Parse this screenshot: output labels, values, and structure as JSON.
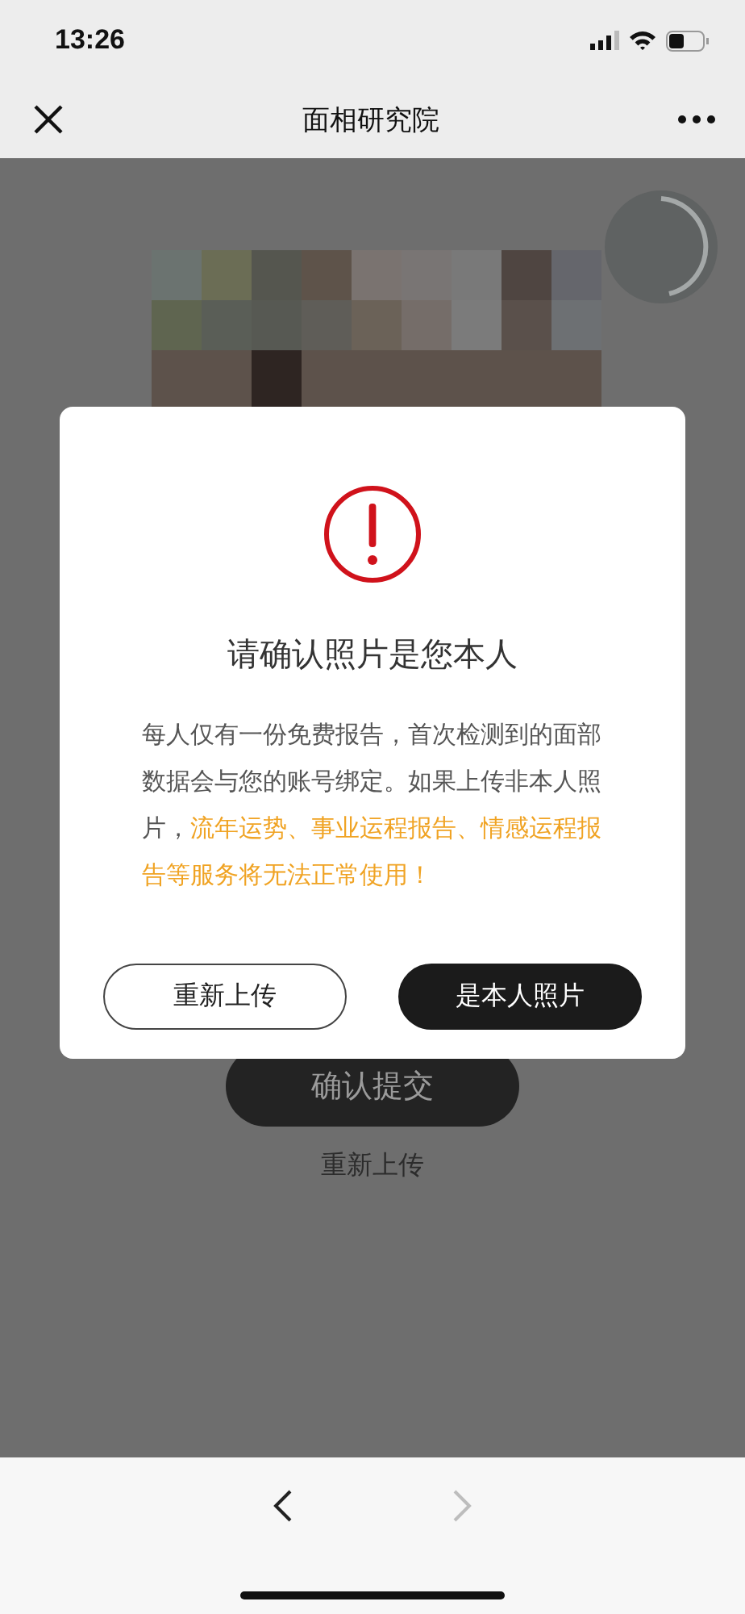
{
  "status_bar": {
    "time": "13:26"
  },
  "nav": {
    "title": "面相研究院"
  },
  "page": {
    "confirm_button": "确认提交",
    "reupload_link": "重新上传"
  },
  "dialog": {
    "title": "请确认照片是您本人",
    "message": [
      {
        "text": "每人仅有一份免费报告，首次检测到的面部数据会与您的账号绑定。如果上传非本人照片，",
        "highlight": false
      },
      {
        "text": "流年运势、事业运程报告、情感运程报告等服务将无法正常使用！",
        "highlight": true
      }
    ],
    "buttons": [
      {
        "label": "重新上传",
        "primary": false
      },
      {
        "label": "是本人照片",
        "primary": true
      }
    ]
  },
  "toolbar": {
    "back": {
      "disabled": false
    },
    "forward": {
      "disabled": true
    }
  }
}
